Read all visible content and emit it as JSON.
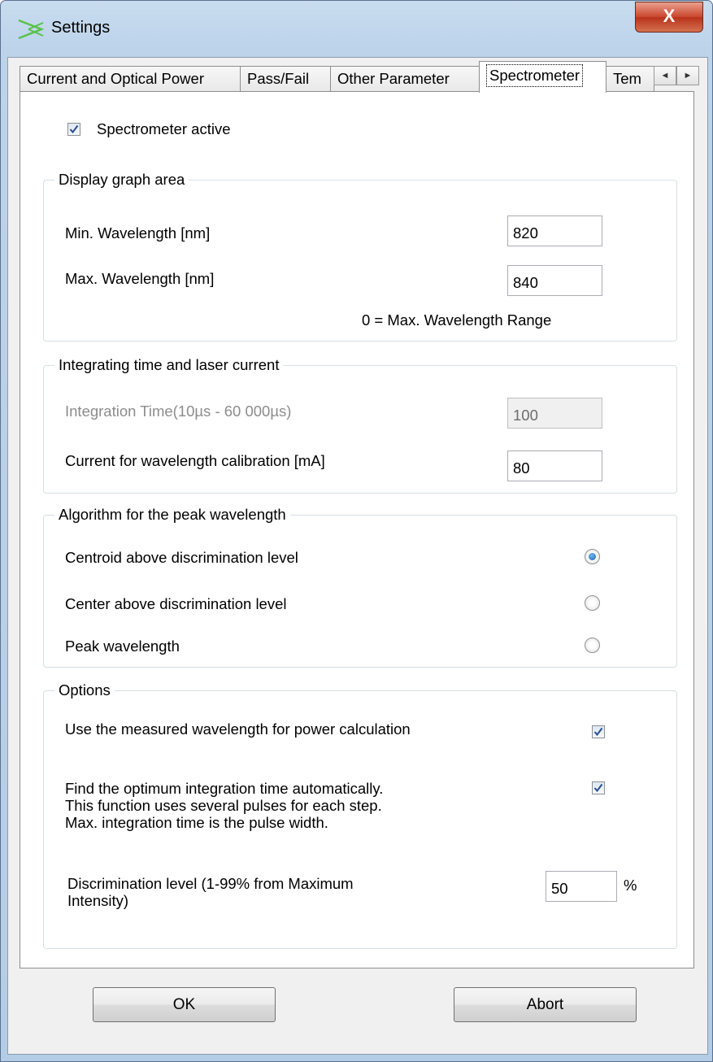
{
  "window": {
    "title": "Settings",
    "close_glyph": "X"
  },
  "tabs": [
    {
      "label": "Current and Optical Power",
      "active": false
    },
    {
      "label": "Pass/Fail",
      "active": false
    },
    {
      "label": "Other Parameter",
      "active": false
    },
    {
      "label": "Spectrometer",
      "active": true
    },
    {
      "label": "Tem",
      "active": false
    }
  ],
  "tab_scroll": {
    "left_glyph": "◄",
    "right_glyph": "►"
  },
  "spectrometer": {
    "active_label": "Spectrometer active",
    "active_checked": true,
    "display_graph": {
      "title": "Display graph area",
      "min_label": "Min. Wavelength [nm]",
      "min_value": "820",
      "max_label": "Max. Wavelength [nm]",
      "max_value": "840",
      "hint": "0 = Max. Wavelength Range"
    },
    "integrating": {
      "title": "Integrating time and laser current",
      "time_label": "Integration Time(10µs - 60 000µs)",
      "time_value": "100",
      "current_label": "Current for wavelength calibration [mA]",
      "current_value": "80"
    },
    "algorithm": {
      "title": "Algorithm for the peak wavelength",
      "options": [
        {
          "label": "Centroid above discrimination level",
          "selected": true
        },
        {
          "label": "Center above discrimination level",
          "selected": false
        },
        {
          "label": "Peak wavelength",
          "selected": false
        }
      ]
    },
    "options": {
      "title": "Options",
      "use_measured_label": "Use the measured wavelength for power calculation",
      "use_measured_checked": true,
      "find_optimum_line1": "Find the optimum integration time automatically.",
      "find_optimum_line2": "This function uses several pulses for each step.",
      "find_optimum_line3": "Max. integration time is the pulse width.",
      "find_optimum_checked": true,
      "discrimination_line1": "Discrimination level (1-99% from Maximum",
      "discrimination_line2": "Intensity)",
      "discrimination_value": "50",
      "discrimination_unit": "%"
    }
  },
  "buttons": {
    "ok_label": "OK",
    "abort_label": "Abort"
  },
  "colors": {
    "close_button": "#c9462c",
    "radio_selected": "#1b5fae",
    "check_mark": "#2a4f8f"
  }
}
